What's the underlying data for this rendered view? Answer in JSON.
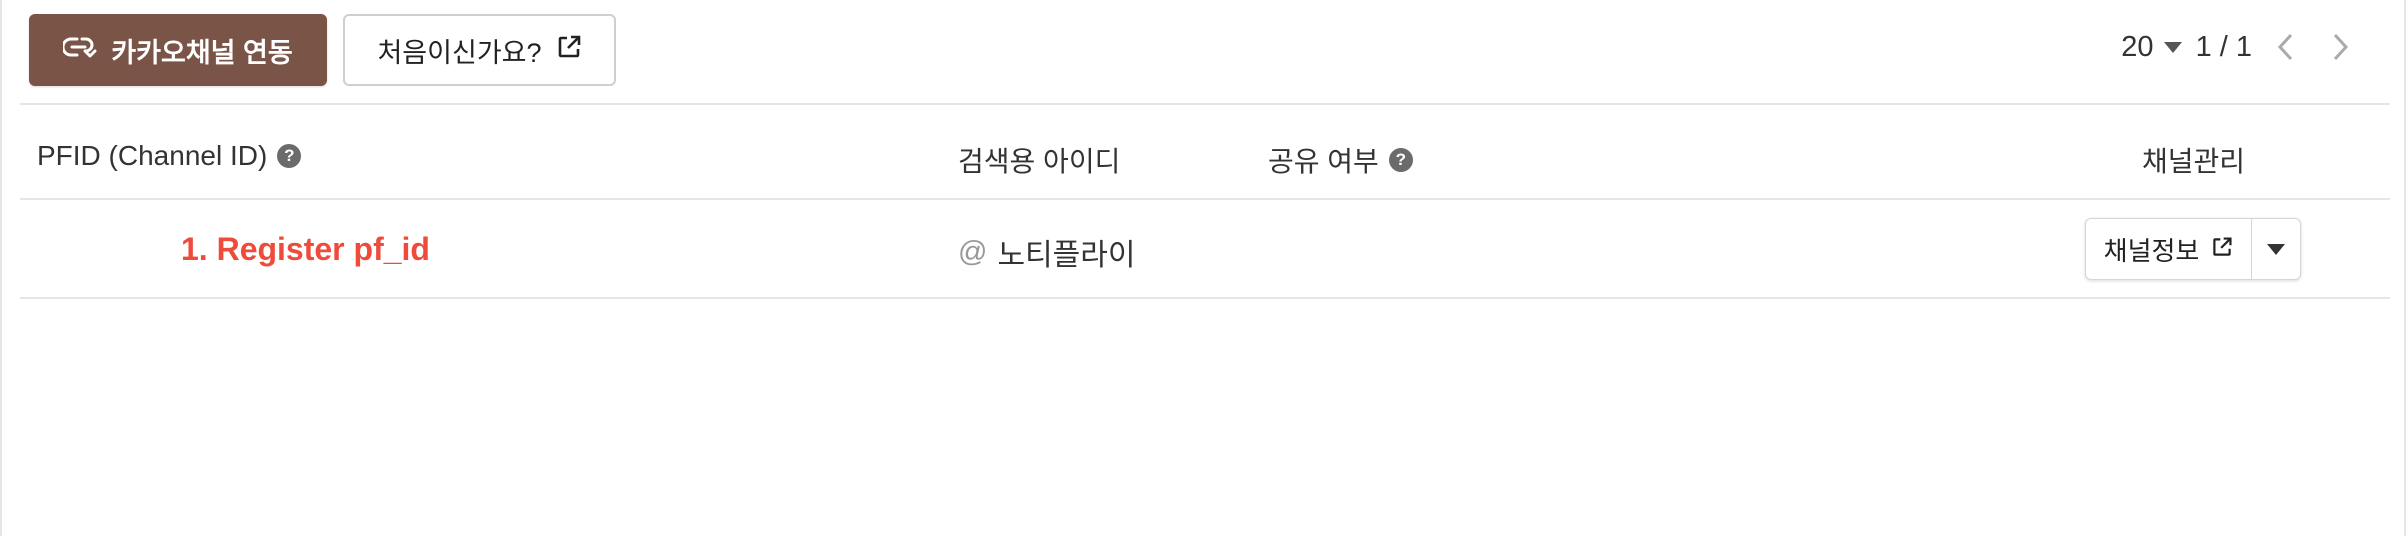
{
  "toolbar": {
    "connect_button": "카카오채널 연동",
    "first_time_button": "처음이신가요?",
    "page_size": "20",
    "page_indicator": "1 / 1"
  },
  "table": {
    "headers": {
      "pfid": "PFID (Channel ID)",
      "search_id": "검색용 아이디",
      "shared": "공유 여부",
      "manage": "채널관리"
    },
    "rows": [
      {
        "pfid": "1. Register pf_id",
        "search_prefix": "@",
        "search_id": "노티플라이",
        "shared": "",
        "manage_button": "채널정보"
      }
    ]
  },
  "colors": {
    "primary": "#7a5446",
    "highlight_text": "#ef4b3a",
    "border": "#e6e6e6"
  },
  "icons": {
    "connect": "link-arrow-icon",
    "external": "external-link-icon",
    "help": "help-circle-icon",
    "prev": "chevron-left-icon",
    "next": "chevron-right-icon",
    "dropdown": "caret-down-icon"
  }
}
